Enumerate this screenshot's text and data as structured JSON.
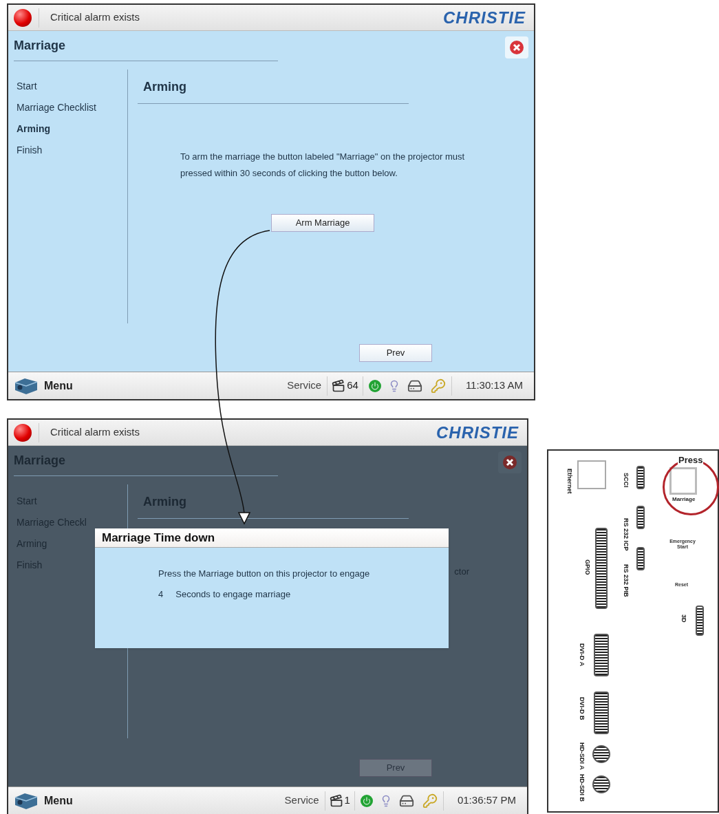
{
  "screens": [
    {
      "alarm_text": "Critical alarm exists",
      "logo": "CHRISTIE",
      "title": "Marriage",
      "dimmed": false,
      "nav": [
        {
          "label": "Start",
          "selected": false
        },
        {
          "label": "Marriage Checklist",
          "selected": false
        },
        {
          "label": "Arming",
          "selected": true
        },
        {
          "label": "Finish",
          "selected": false
        }
      ],
      "heading": "Arming",
      "message": "To arm the marriage the button labeled \"Marriage\" on the projector must pressed within 30 seconds of clicking the button below.",
      "arm_button": "Arm Marriage",
      "prev_button": "Prev",
      "status": {
        "menu": "Menu",
        "service": "Service",
        "count": "64",
        "time": "11:30:13 AM"
      }
    },
    {
      "alarm_text": "Critical alarm exists",
      "logo": "CHRISTIE",
      "title": "Marriage",
      "dimmed": true,
      "nav": [
        {
          "label": "Start",
          "selected": false
        },
        {
          "label": "Marriage Checkl",
          "selected": false
        },
        {
          "label": "Arming",
          "selected": false
        },
        {
          "label": "Finish",
          "selected": false
        }
      ],
      "heading": "Arming",
      "message": "ctor",
      "prev_button": "Prev",
      "dialog": {
        "title": "Marriage Time down",
        "text": "Press the Marriage button on this projector to engage",
        "countdown": "4",
        "countdown_label": "Seconds to engage marriage"
      },
      "status": {
        "menu": "Menu",
        "service": "Service",
        "count": "1",
        "time": "01:36:57 PM"
      }
    }
  ],
  "panel": {
    "callout": "Press",
    "labels": {
      "ethernet": "Ethernet",
      "scci": "SCCI",
      "rs232_icp": "RS 232 ICP",
      "rs232_pib": "RS 232 PIB",
      "gpio": "GPIO",
      "dvi_a": "DVI-D A",
      "dvi_b": "DVI-D B",
      "sdi_a": "HD-SDI A",
      "sdi_b": "HD-SDI B",
      "marriage": "Marriage",
      "emergency": "Emergency Start",
      "reset": "Reset",
      "three_d": "3D"
    }
  }
}
